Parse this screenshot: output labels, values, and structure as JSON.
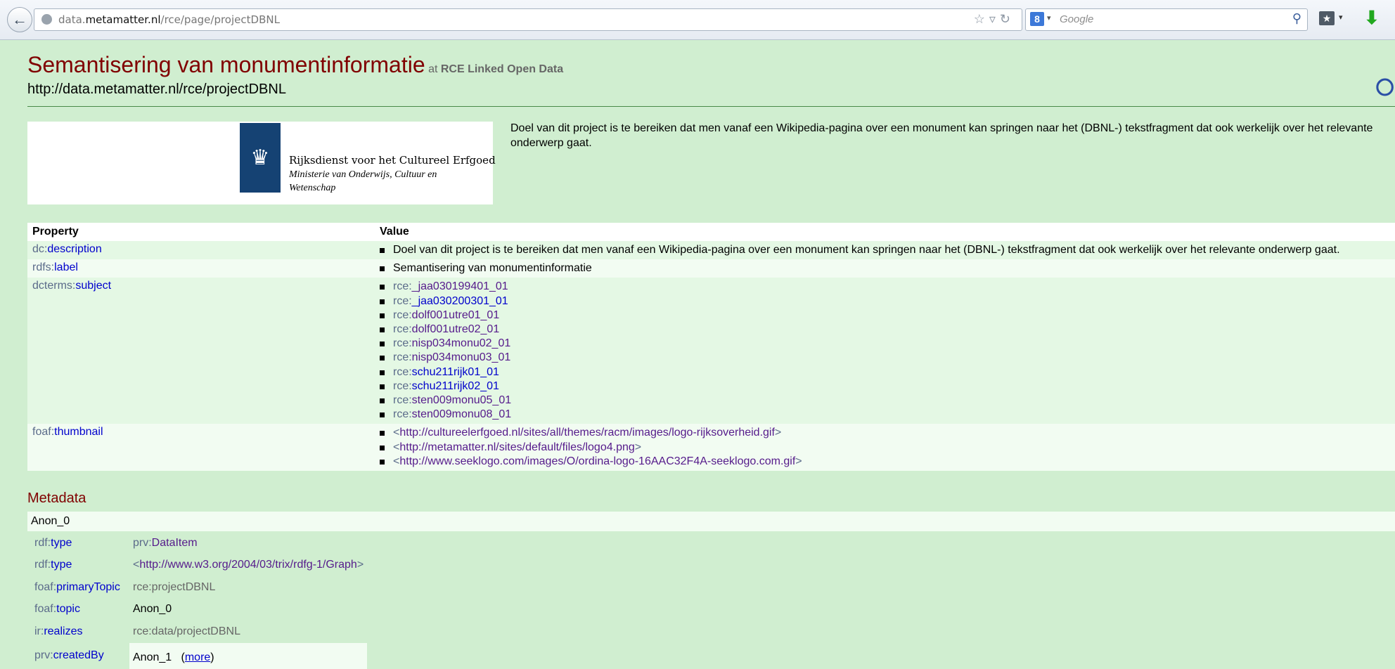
{
  "browser": {
    "url_prefix": "data.",
    "url_host": "metamatter.nl",
    "url_path": "/rce/page/projectDBNL",
    "search_placeholder": "Google",
    "search_engine_badge": "8"
  },
  "header": {
    "title": "Semantisering van monumentinformatie",
    "at": "at",
    "site": "RCE Linked Open Data",
    "uri": "http://data.metamatter.nl/rce/projectDBNL"
  },
  "logo": {
    "org_name": "Rijksdienst voor het Cultureel Erfgoed",
    "org_sub": "Ministerie van Onderwijs, Cultuur en Wetenschap"
  },
  "intro": "Doel van dit project is te bereiken dat men vanaf een Wikipedia-pagina over een monument kan springen naar het (DBNL-) tekstfragment dat ook werkelijk over het relevante onderwerp gaat.",
  "table": {
    "header_property": "Property",
    "header_value": "Value",
    "rows": [
      {
        "prefix": "dc:",
        "name": "description",
        "values": [
          "Doel van dit project is te bereiken dat men vanaf een Wikipedia-pagina over een monument kan springen naar het (DBNL-) tekstfragment dat ook werkelijk over het relevante onderwerp gaat."
        ]
      },
      {
        "prefix": "rdfs:",
        "name": "label",
        "values": [
          "Semantisering van monumentinformatie"
        ]
      },
      {
        "prefix": "dcterms:",
        "name": "subject",
        "values": [
          {
            "pfx": "rce:",
            "local": "_jaa030199401_01"
          },
          {
            "pfx": "rce:",
            "local": "_jaa030200301_01"
          },
          {
            "pfx": "rce:",
            "local": "dolf001utre01_01"
          },
          {
            "pfx": "rce:",
            "local": "dolf001utre02_01"
          },
          {
            "pfx": "rce:",
            "local": "nisp034monu02_01"
          },
          {
            "pfx": "rce:",
            "local": "nisp034monu03_01"
          },
          {
            "pfx": "rce:",
            "local": "schu211rijk01_01"
          },
          {
            "pfx": "rce:",
            "local": "schu211rijk02_01"
          },
          {
            "pfx": "rce:",
            "local": "sten009monu05_01"
          },
          {
            "pfx": "rce:",
            "local": "sten009monu08_01"
          }
        ]
      },
      {
        "prefix": "foaf:",
        "name": "thumbnail",
        "values": [
          "http://cultureelerfgoed.nl/sites/all/themes/racm/images/logo-rijksoverheid.gif",
          "http://metamatter.nl/sites/default/files/logo4.png",
          "http://www.seeklogo.com/images/O/ordina-logo-16AAC32F4A-seeklogo.com.gif"
        ]
      }
    ]
  },
  "metadata": {
    "title": "Metadata",
    "anon": "Anon_0",
    "rows": [
      {
        "kp": "rdf:",
        "kn": "type",
        "vp": "prv:",
        "vn": "DataItem"
      },
      {
        "kp": "rdf:",
        "kn": "type",
        "vp": "",
        "vn": "http://www.w3.org/2004/03/trix/rdfg-1/Graph"
      },
      {
        "kp": "foaf:",
        "kn": "primaryTopic",
        "vp": "rce:",
        "vn": "projectDBNL"
      },
      {
        "kp": "foaf:",
        "kn": "topic",
        "vp": "",
        "vn": "Anon_0"
      },
      {
        "kp": "ir:",
        "kn": "realizes",
        "vp": "rce:",
        "vn": "data/projectDBNL"
      },
      {
        "kp": "prv:",
        "kn": "createdBy",
        "vp": "",
        "vn": "Anon_1",
        "more": "more"
      }
    ]
  }
}
